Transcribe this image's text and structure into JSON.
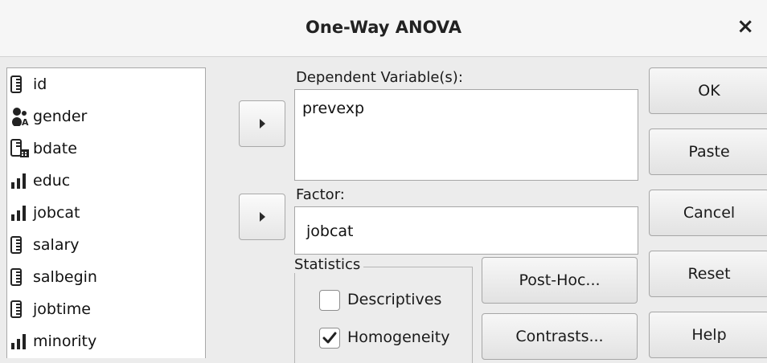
{
  "window": {
    "title": "One-Way ANOVA",
    "close_label": "×"
  },
  "variables": [
    {
      "name": "id",
      "icon": "scale-ruler-icon"
    },
    {
      "name": "gender",
      "icon": "nominal-people-icon"
    },
    {
      "name": "bdate",
      "icon": "date-ruler-icon"
    },
    {
      "name": "educ",
      "icon": "ordinal-bars-icon"
    },
    {
      "name": "jobcat",
      "icon": "ordinal-bars-icon"
    },
    {
      "name": "salary",
      "icon": "scale-ruler-icon"
    },
    {
      "name": "salbegin",
      "icon": "scale-ruler-icon"
    },
    {
      "name": "jobtime",
      "icon": "scale-ruler-icon"
    },
    {
      "name": "minority",
      "icon": "ordinal-bars-icon"
    }
  ],
  "dependent": {
    "label": "Dependent Variable(s):",
    "value": "prevexp"
  },
  "factor": {
    "label": "Factor:",
    "value": "jobcat"
  },
  "statistics": {
    "legend": "Statistics",
    "descriptives": {
      "label": "Descriptives",
      "checked": false
    },
    "homogeneity": {
      "label": "Homogeneity",
      "checked": true
    }
  },
  "buttons": {
    "ok": "OK",
    "paste": "Paste",
    "cancel": "Cancel",
    "reset": "Reset",
    "help": "Help",
    "posthoc": "Post-Hoc...",
    "contrasts": "Contrasts..."
  }
}
